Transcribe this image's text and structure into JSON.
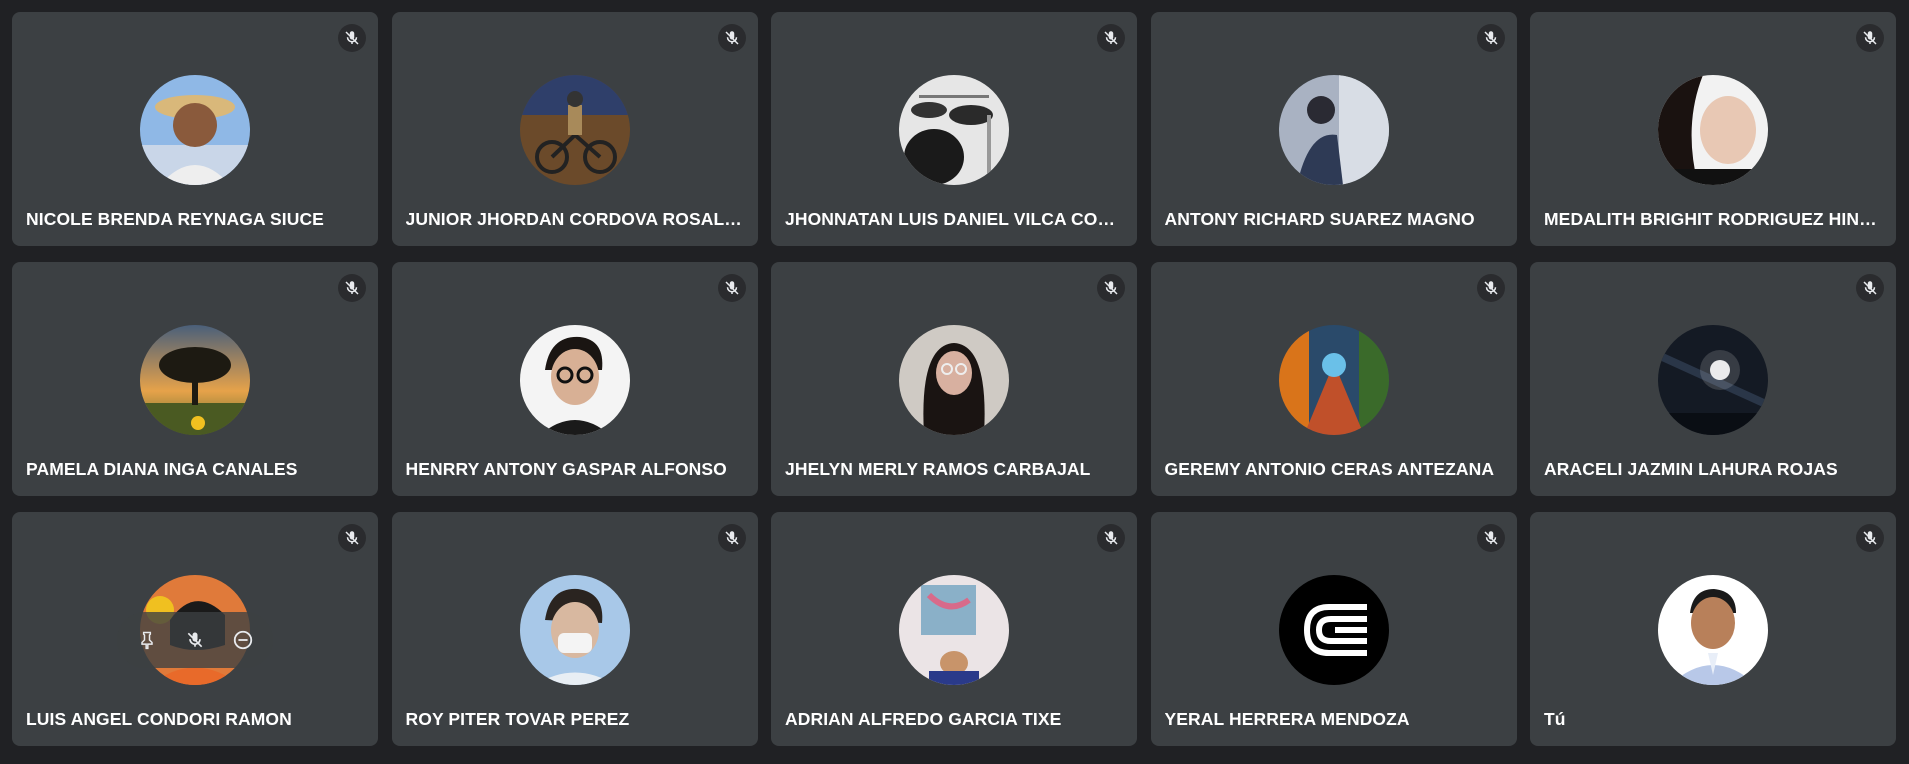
{
  "participants": [
    {
      "name": "NICOLE BRENDA REYNAGA SIUCE",
      "muted": true
    },
    {
      "name": "JUNIOR JHORDAN CORDOVA ROSALES",
      "muted": true
    },
    {
      "name": "JHONNATAN LUIS DANIEL VILCA CONT...",
      "muted": true
    },
    {
      "name": "ANTONY RICHARD SUAREZ MAGNO",
      "muted": true
    },
    {
      "name": "MEDALITH BRIGHIT RODRIGUEZ HINOS...",
      "muted": true
    },
    {
      "name": "PAMELA DIANA INGA CANALES",
      "muted": true
    },
    {
      "name": "HENRRY ANTONY GASPAR ALFONSO",
      "muted": true
    },
    {
      "name": "JHELYN MERLY RAMOS CARBAJAL",
      "muted": true
    },
    {
      "name": "GEREMY ANTONIO CERAS ANTEZANA",
      "muted": true
    },
    {
      "name": "ARACELI JAZMIN LAHURA ROJAS",
      "muted": true
    },
    {
      "name": "LUIS ANGEL CONDORI RAMON",
      "muted": true
    },
    {
      "name": "ROY PITER TOVAR PEREZ",
      "muted": true
    },
    {
      "name": "ADRIAN ALFREDO GARCIA TIXE",
      "muted": true
    },
    {
      "name": "YERAL HERRERA MENDOZA",
      "muted": true
    },
    {
      "name": "Tú",
      "muted": true
    }
  ],
  "icons": {
    "mic_off": "mic-off-icon",
    "pin": "pin-icon",
    "remove": "remove-icon"
  },
  "colors": {
    "background": "#202124",
    "tile": "#3c4043",
    "text": "#ffffff"
  }
}
